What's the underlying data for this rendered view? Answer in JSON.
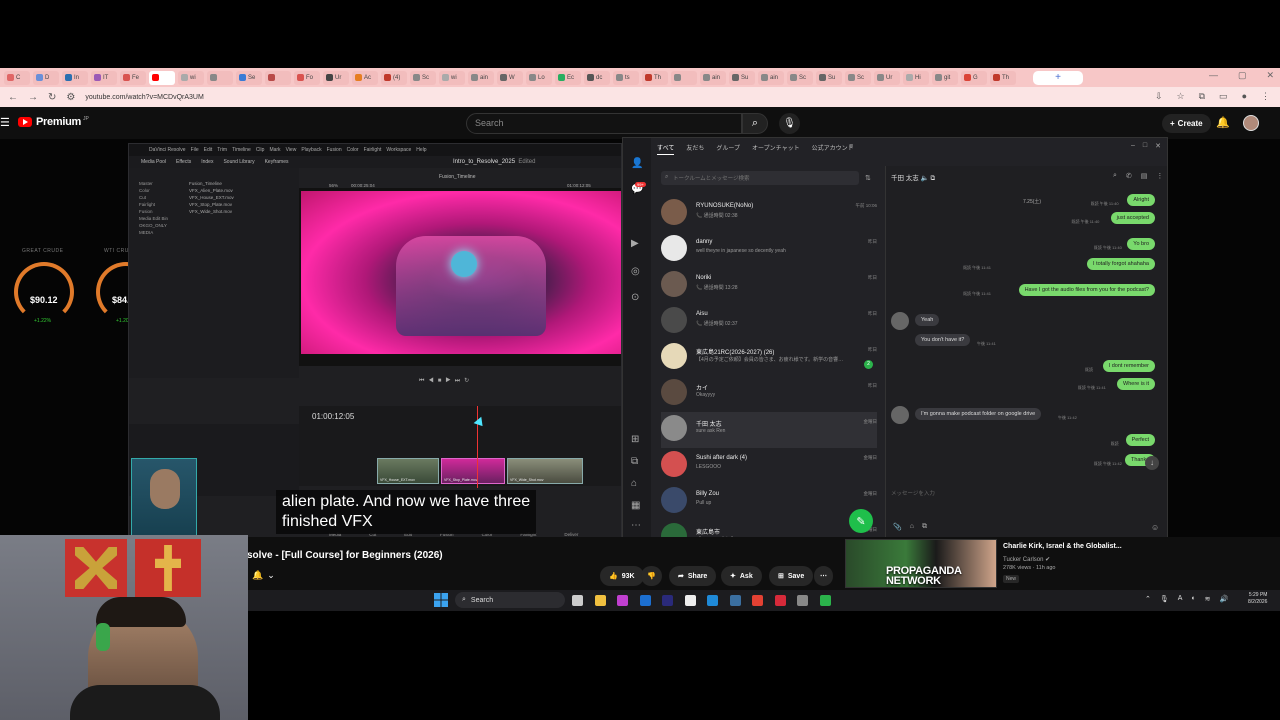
{
  "browser": {
    "tabs": [
      {
        "label": "C",
        "color": "#e06666"
      },
      {
        "label": "D",
        "color": "#6a8fd8"
      },
      {
        "label": "In",
        "color": "#2a6fb0"
      },
      {
        "label": "IT",
        "color": "#9b59b6"
      },
      {
        "label": "Fe",
        "color": "#d9534f"
      },
      {
        "label": "",
        "color": "#ff0000"
      },
      {
        "label": "wi",
        "color": "#aaaaaa"
      },
      {
        "label": "",
        "color": "#888888"
      },
      {
        "label": "Se",
        "color": "#3a7bd5"
      },
      {
        "label": "",
        "color": "#b94a48"
      },
      {
        "label": "Fo",
        "color": "#d9534f"
      },
      {
        "label": "Ur",
        "color": "#444444"
      },
      {
        "label": "Ac",
        "color": "#e67e22"
      },
      {
        "label": "(4)",
        "color": "#c0392b"
      },
      {
        "label": "Sc",
        "color": "#888888"
      },
      {
        "label": "wi",
        "color": "#aaaaaa"
      },
      {
        "label": "ain",
        "color": "#888888"
      },
      {
        "label": "W",
        "color": "#666666"
      },
      {
        "label": "Lo",
        "color": "#888888"
      },
      {
        "label": "Ec",
        "color": "#27ae60"
      },
      {
        "label": "dc",
        "color": "#555555"
      },
      {
        "label": "ts",
        "color": "#888888"
      },
      {
        "label": "Th",
        "color": "#c0392b"
      },
      {
        "label": "",
        "color": "#888888"
      },
      {
        "label": "ain",
        "color": "#888888"
      },
      {
        "label": "Su",
        "color": "#666666"
      },
      {
        "label": "ain",
        "color": "#888888"
      },
      {
        "label": "Sc",
        "color": "#888888"
      },
      {
        "label": "Su",
        "color": "#666666"
      },
      {
        "label": "Sc",
        "color": "#888888"
      },
      {
        "label": "Ur",
        "color": "#888888"
      },
      {
        "label": "Hi",
        "color": "#aaaaaa"
      },
      {
        "label": "git",
        "color": "#888888"
      },
      {
        "label": "G",
        "color": "#db4437"
      },
      {
        "label": "Th",
        "color": "#c0392b"
      }
    ],
    "url": "youtube.com/watch?v=MCDvQrA3UM"
  },
  "youtube": {
    "logo_text": "Premium",
    "logo_sup": "JP",
    "search_placeholder": "Search",
    "create_label": "Create",
    "video_title": "solve - [Full Course] for Beginners (2026)",
    "likes": "93K",
    "share_label": "Share",
    "ask_label": "Ask",
    "save_label": "Save",
    "subtitle_line1": "alien plate. And now we have three",
    "subtitle_line2": "finished VFX",
    "recommended": {
      "thumb_text_1": "PROPAGANDA",
      "thumb_text_2": "NETWORK",
      "title": "Charlie Kirk, Israel & the Globalist...",
      "channel": "Tucker Carlson",
      "meta": "278K views · 11h ago",
      "new_badge": "New"
    }
  },
  "gauges": [
    {
      "label": "GREAT CRUDE",
      "value": "$90.12",
      "change": "+1.22%"
    },
    {
      "label": "WTI CRUDE",
      "value": "$84.67",
      "change": "+1.20%"
    }
  ],
  "resolve": {
    "menu": [
      "DaVinci Resolve",
      "File",
      "Edit",
      "Trim",
      "Timeline",
      "Clip",
      "Mark",
      "View",
      "Playback",
      "Fusion",
      "Color",
      "Fairlight",
      "Workspace",
      "Help"
    ],
    "toolbar": [
      "Media Pool",
      "Effects",
      "Index",
      "Sound Library",
      "Keyframes"
    ],
    "project_title": "Intro_to_Resolve_2025",
    "project_status": "Edited",
    "timeline_name": "Fusion_Timeline",
    "viewer_zoom": "56%",
    "viewer_tc": "00:00:25:04",
    "viewer_tc_right": "01:00:12:05",
    "bins": [
      "Master",
      "Color",
      "Cut",
      "Fairlight",
      "Fusion",
      "Media Edit Bin",
      "OKGO_ONLY",
      "MEDIA"
    ],
    "clips": [
      "Fusion_Timeline",
      "VFX_Alien_Plate.mov",
      "VFX_House_EXT.mov",
      "VFX_Stop_Plate.mov",
      "VFX_Wide_Shot.mov"
    ],
    "timecode": "01:00:12:05",
    "tracks": [
      "V2  Video 2",
      "V1  Video 1"
    ],
    "clip_labels": [
      "VFX_House_EXT.mov",
      "VFX_Stop_Plate.mov",
      "VFX_Wide_Shot.mov"
    ],
    "pages": [
      "Media",
      "Cut",
      "Edit",
      "Fusion",
      "Color",
      "Fairlight",
      "Deliver"
    ]
  },
  "line_app": {
    "tabs": [
      "すべて",
      "友だち",
      "グループ",
      "オープンチャット",
      "公式アカウント"
    ],
    "badge_count": "99+",
    "search_placeholder": "トークルームとメッセージ検索",
    "chats": [
      {
        "name": "RYUNOSUKE(NoNo)",
        "preview": "📞 通話時間 02:38",
        "date": "午前 10:06",
        "avatar": "#7a5c4a"
      },
      {
        "name": "danny",
        "preview": "well theyre in japanese so decently yeah",
        "date": "昨日",
        "avatar": "#e8e8e8"
      },
      {
        "name": "Noriki",
        "preview": "📞 通話時間 13:28",
        "date": "昨日",
        "avatar": "#6b5a50"
      },
      {
        "name": "Aisu",
        "preview": "📞 通話時間 02:37",
        "date": "昨日",
        "avatar": "#4a4a4a"
      },
      {
        "name": "東広島21RC(2026-2027) (26)",
        "preview": "【4月の予定ご依頼】会員の皆さま、お疲れ様です。新学の音響…",
        "date": "昨日",
        "avatar": "#e6d9b8",
        "badge": "2"
      },
      {
        "name": "カイ",
        "preview": "Okayyyy",
        "date": "昨日",
        "avatar": "#5a4a40"
      },
      {
        "name": "千田 太志",
        "preview": "sure ask Ren",
        "date": "金曜日",
        "avatar": "#8a8a8a",
        "selected": true
      },
      {
        "name": "Sushi after dark (4)",
        "preview": "LESGOOO",
        "date": "金曜日",
        "avatar": "#d45050"
      },
      {
        "name": "Billy Zou",
        "preview": "Pull up",
        "date": "金曜日",
        "avatar": "#3a4a6a"
      },
      {
        "name": "東広島市",
        "preview": "【イベント告知】…",
        "date": "金曜日",
        "avatar": "#2a6a3a"
      }
    ],
    "chat_header": "千田 太志",
    "date_divider": "7.25(土)",
    "messages": [
      {
        "text": "Alright",
        "from": "me",
        "time": "既読 午後 11:40"
      },
      {
        "text": "just accepted",
        "from": "me",
        "time": "既読 午後 11:40"
      },
      {
        "text": "Yo bro",
        "from": "me",
        "time": "既読 午後 11:40"
      },
      {
        "text": "I totally forgot ahahaha",
        "from": "me",
        "time": "既読 午後 11:41"
      },
      {
        "text": "Have I got the audio files from you for the podcast?",
        "from": "me",
        "time": "既読 午後 11:41"
      },
      {
        "text": "Yeah",
        "from": "them",
        "time": ""
      },
      {
        "text": "You don't have it?",
        "from": "them",
        "time": "午後 11:41"
      },
      {
        "text": "I dont remember",
        "from": "me",
        "time": "既読"
      },
      {
        "text": "Where is it",
        "from": "me",
        "time": "既読 午後 11:41"
      },
      {
        "text": "I'm gonna make podcast folder on google drive",
        "from": "them",
        "time": "午後 11:42"
      },
      {
        "text": "Perfect",
        "from": "me",
        "time": "既読"
      },
      {
        "text": "Thanks",
        "from": "me",
        "time": "既読 午後 11:42"
      }
    ],
    "input_placeholder": "メッセージを入力"
  },
  "taskbar": {
    "search_label": "Search",
    "time": "5:29 PM",
    "date": "8/2/2026",
    "icons": [
      {
        "name": "task-view-icon",
        "color": "#cccccc"
      },
      {
        "name": "file-explorer-icon",
        "color": "#f0c040"
      },
      {
        "name": "adobe-xd-icon",
        "color": "#c03fd0"
      },
      {
        "name": "lightroom-icon",
        "color": "#1c6fd1"
      },
      {
        "name": "premiere-icon",
        "color": "#2a2a7a"
      },
      {
        "name": "capcut-icon",
        "color": "#eeeeee"
      },
      {
        "name": "edge-icon",
        "color": "#1f8ad8"
      },
      {
        "name": "steam-icon",
        "color": "#3b6fa0"
      },
      {
        "name": "chrome-icon",
        "color": "#e34133"
      },
      {
        "name": "opera-icon",
        "color": "#d62a3a"
      },
      {
        "name": "obs-icon",
        "color": "#888888"
      },
      {
        "name": "line-icon",
        "color": "#2bb34b"
      }
    ]
  }
}
